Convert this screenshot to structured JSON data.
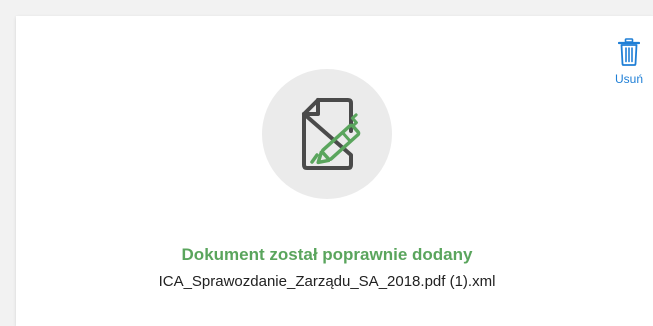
{
  "upload": {
    "delete_label": "Usuń",
    "status": "Dokument został poprawnie dodany",
    "file_name": "ICA_Sprawozdanie_Zarządu_SA_2018.pdf (1).xml"
  },
  "icons": {
    "delete": "trash-icon",
    "document": "document-sign-icon"
  },
  "colors": {
    "success": "#5aa55d",
    "link": "#1f7fd6",
    "circle_bg": "#ebebeb",
    "icon_dark": "#4a4a4a"
  }
}
